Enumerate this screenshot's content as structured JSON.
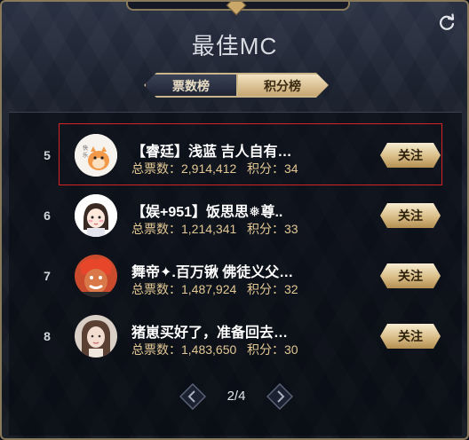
{
  "header": {
    "title": "最佳MC",
    "refresh_icon": "refresh-icon"
  },
  "tabs": [
    {
      "label": "票数榜",
      "active": false
    },
    {
      "label": "积分榜",
      "active": true
    }
  ],
  "rows": [
    {
      "rank": "5",
      "name": "【睿廷】浅蓝 吉人自有…",
      "votes_label": "总票数：",
      "votes": "2,914,412",
      "score_label": "积分：",
      "score": "34",
      "follow": "关注",
      "selected": true,
      "avatar": "cartoon-avatar"
    },
    {
      "rank": "6",
      "name": "【娱+951】饭思思❅尊..",
      "votes_label": "总票数：",
      "votes": "1,214,341",
      "score_label": "积分：",
      "score": "33",
      "follow": "关注",
      "selected": false,
      "avatar": "girl-drawing-avatar"
    },
    {
      "rank": "7",
      "name": "舞帝✦.百万锹 佛徒义父…",
      "votes_label": "总票数：",
      "votes": "1,487,924",
      "score_label": "积分：",
      "score": "32",
      "follow": "关注",
      "selected": false,
      "avatar": "red-face-avatar"
    },
    {
      "rank": "8",
      "name": "猪崽买好了，准备回去…",
      "votes_label": "总票数：",
      "votes": "1,483,650",
      "score_label": "积分：",
      "score": "30",
      "follow": "关注",
      "selected": false,
      "avatar": "woman-photo-avatar"
    }
  ],
  "pager": {
    "text": "2/4",
    "prev_icon": "chevron-left-icon",
    "next_icon": "chevron-right-icon"
  },
  "colors": {
    "gold": "#d9bd87",
    "stats": "#e3c894",
    "selection": "#d62424"
  }
}
